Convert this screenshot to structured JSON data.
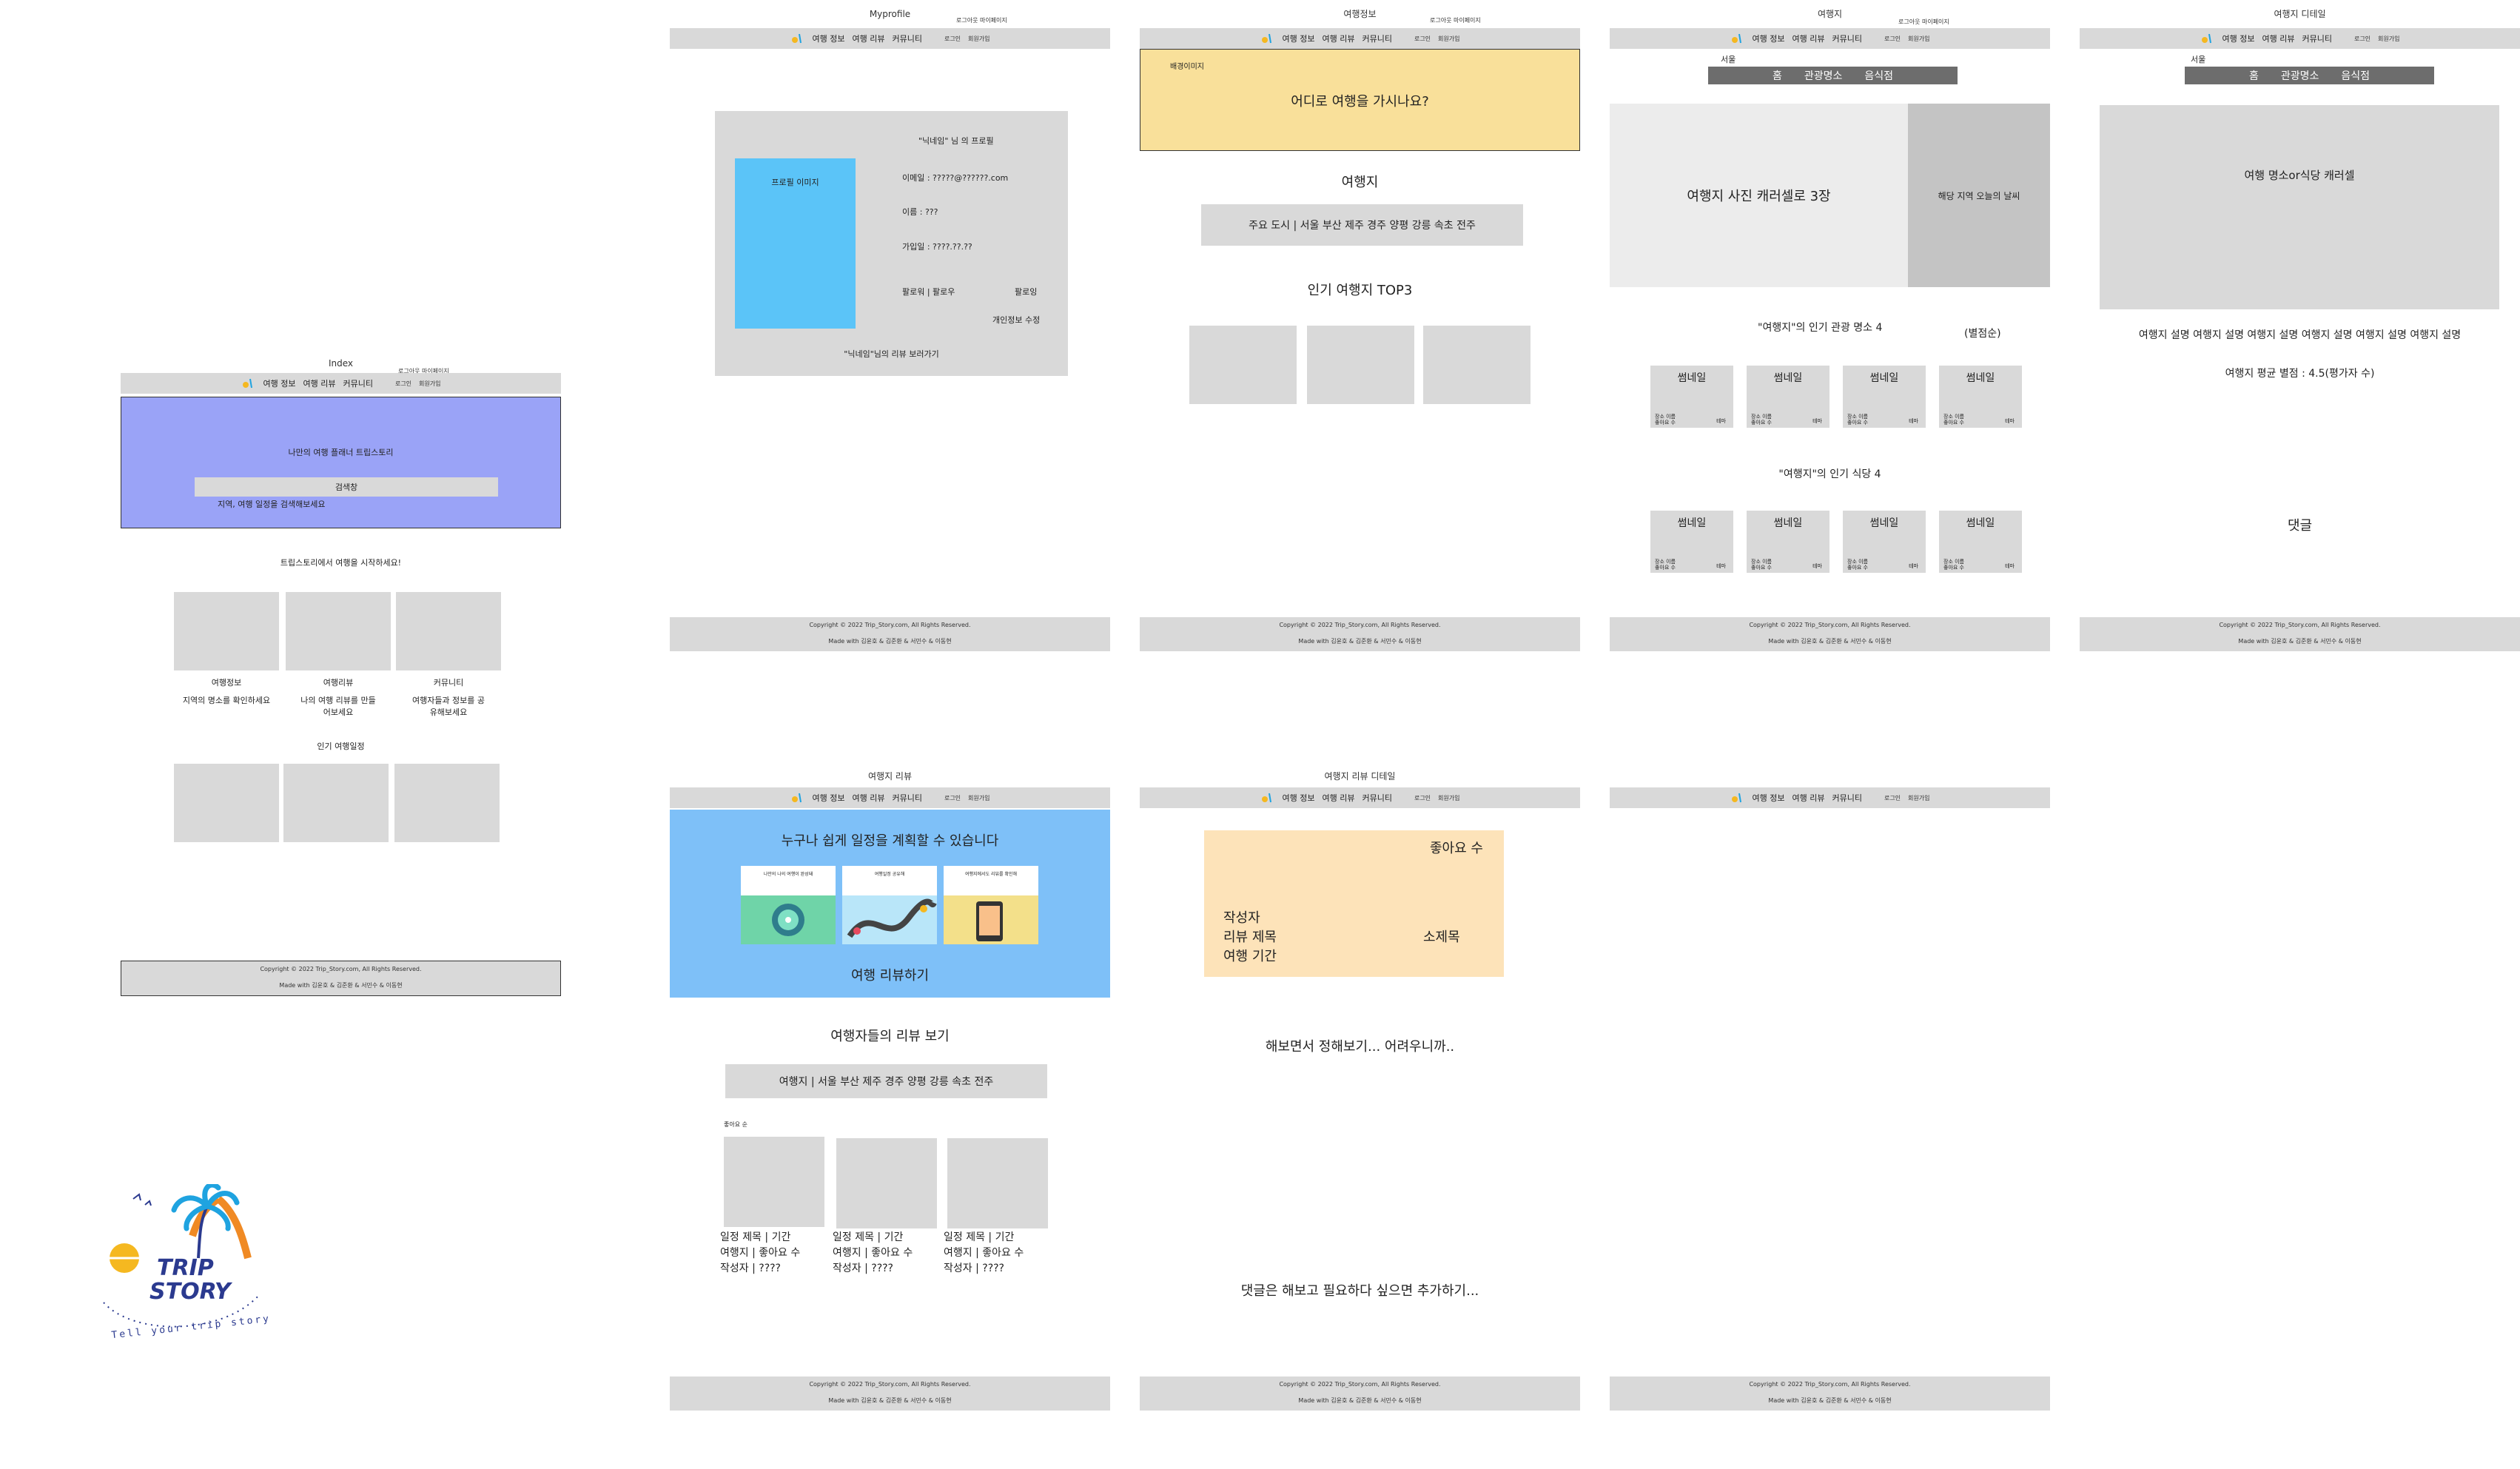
{
  "common": {
    "nav": {
      "menu1": "여행 정보",
      "menu2": "여행 리뷰",
      "menu3": "커뮤니티",
      "login": "로그인",
      "signup": "회원가입"
    },
    "top_links": "로그아웃 마이페이지",
    "footer_line1": "Copyright © 2022 Trip_Story.com, All Rights Reserved.",
    "footer_line2": "Made with 김윤호 & 김준환 & 서민수 & 이동현"
  },
  "index": {
    "title": "Index",
    "hero_title": "나만의 여행 플래너 트립스토리",
    "search_button": "검색창",
    "search_placeholder": "지역, 여행 일정을 검색해보세요",
    "start_text": "트립스토리에서 여행을 시작하세요!",
    "cards": [
      {
        "title": "여행정보",
        "desc": "지역의 명소를 확인하세요"
      },
      {
        "title": "여행리뷰",
        "desc": "나의 여행 리뷰를 만들어보세요"
      },
      {
        "title": "커뮤니티",
        "desc": "여행자들과 정보를 공유해보세요"
      }
    ],
    "popular_title": "인기 여행일정"
  },
  "myprofile": {
    "title": "Myprofile",
    "profile_heading": "\"닉네임\" 님 의 프로필",
    "profile_image": "프로필 이미지",
    "email": "이메일 : ?????@??????.com",
    "name": "이름 : ???",
    "joined": "가입일 : ????.??.??",
    "follow": "팔로워 | 팔로우",
    "follow_btn": "팔로잉",
    "edit": "개인정보 수정",
    "reviews_link": "\"닉네임\"님의 리뷰 보러가기"
  },
  "travel_info": {
    "title": "여행정보",
    "bg_label": "배경이미지",
    "question": "어디로 여행을 가시나요?",
    "dest_title": "여행지",
    "cities": "주요 도시 | 서울   부산   제주   경주   양평   강릉   속초   전주",
    "top3": "인기 여행지 TOP3"
  },
  "destination": {
    "title": "여행지",
    "city": "서울",
    "tabs": [
      "홈",
      "관광명소",
      "음식점"
    ],
    "carousel": "여행지 사진 캐러셀로 3장",
    "weather": "해당 지역 오늘의 날씨",
    "attractions_title": "\"여행지\"의 인기 관광 명소 4",
    "rating_note": "(별점순)",
    "restaurants_title": "\"여행지\"의 인기 식당 4",
    "thumb_title": "썸네일",
    "thumb_place": "장소 이름",
    "thumb_likes": "좋아요 수",
    "thumb_theme": "테마"
  },
  "destination_detail": {
    "title": "여행지 디테일",
    "city": "서울",
    "tabs": [
      "홈",
      "관광명소",
      "음식점"
    ],
    "carousel": "여행 명소or식당 캐러셀",
    "description": "여행지 설명 여행지 설명 여행지 설명 여행지 설명 여행지 설명 여행지 설명",
    "rating": "여행지 평균 별점 : 4.5(평가자 수)",
    "comments": "댓글"
  },
  "review": {
    "title": "여행지 리뷰",
    "banner_title": "누구나 쉽게 일정을 계획할 수 있습니다",
    "banner_cards": [
      "나만의 나의 여행이 완성돼",
      "여행일정 공유해",
      "여행지에서도 리뷰를 확인해"
    ],
    "banner_sub": "여행 리뷰하기",
    "list_title": "여행자들의 리뷰 보기",
    "cities": "여행지 | 서울   부산   제주   경주   양평   강릉   속초   전주",
    "sort_label": "좋아요 순",
    "items": [
      {
        "line1": "일정 제목 | 기간",
        "line2": "여행지 | 좋아요 수",
        "line3": "작성자 | ????"
      },
      {
        "line1": "일정 제목 | 기간",
        "line2": "여행지 | 좋아요 수",
        "line3": "작성자 | ????"
      },
      {
        "line1": "일정 제목 | 기간",
        "line2": "여행지 | 좋아요 수",
        "line3": "작성자 | ????"
      }
    ]
  },
  "review_detail": {
    "title": "여행지 리뷰 디테일",
    "likes": "좋아요 수",
    "author": "작성자",
    "review_title": "리뷰 제목",
    "period": "여행 기간",
    "subtitle": "소제목",
    "note1": "해보면서 정해보기... 어려우니까..",
    "note2": "댓글은 해보고 필요하다 싶으면 추가하기..."
  },
  "logo": {
    "line1": "TRIP",
    "line2": "STORY",
    "tagline": "Tell your trip story",
    "colors": {
      "text": "#2b3a8f",
      "palm": "#1fa3e0",
      "sun": "#f5b820",
      "arc": "#f08a24"
    }
  },
  "colors": {
    "nav_gray": "#d9d9d9",
    "hero_purple": "#9aa3f7",
    "profile_blue": "#5bc4f8",
    "info_yellow": "#f9e09a",
    "review_blue": "#7ec0f8",
    "detail_peach": "#fde3b9",
    "dark_tab": "#6d6d6d"
  }
}
